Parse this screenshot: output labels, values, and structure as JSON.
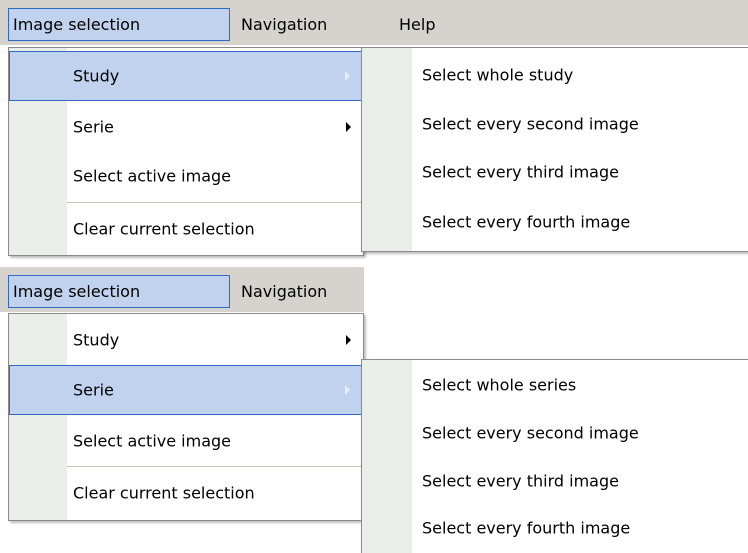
{
  "panel1": {
    "menubar": [
      "Image selection",
      "Navigation",
      "Help"
    ],
    "menu": [
      {
        "label": "Study",
        "submenu": true
      },
      {
        "label": "Serie",
        "submenu": true
      },
      {
        "label": "Select active image"
      },
      {
        "label": "Clear current selection"
      }
    ],
    "submenu": [
      "Select whole study",
      "Select every second image",
      "Select every third image",
      "Select every fourth image"
    ]
  },
  "panel2": {
    "menubar": [
      "Image selection",
      "Navigation"
    ],
    "menu": [
      {
        "label": "Study",
        "submenu": true
      },
      {
        "label": "Serie",
        "submenu": true
      },
      {
        "label": "Select active image"
      },
      {
        "label": "Clear current selection"
      }
    ],
    "submenu": [
      "Select whole series",
      "Select every second image",
      "Select every third image",
      "Select every fourth image"
    ]
  },
  "colors": {
    "menubar_bg": "#d6d3ce",
    "highlight_bg": "#c1d2ee",
    "highlight_border": "#316ac5",
    "gutter_bg": "#e9eee9"
  }
}
